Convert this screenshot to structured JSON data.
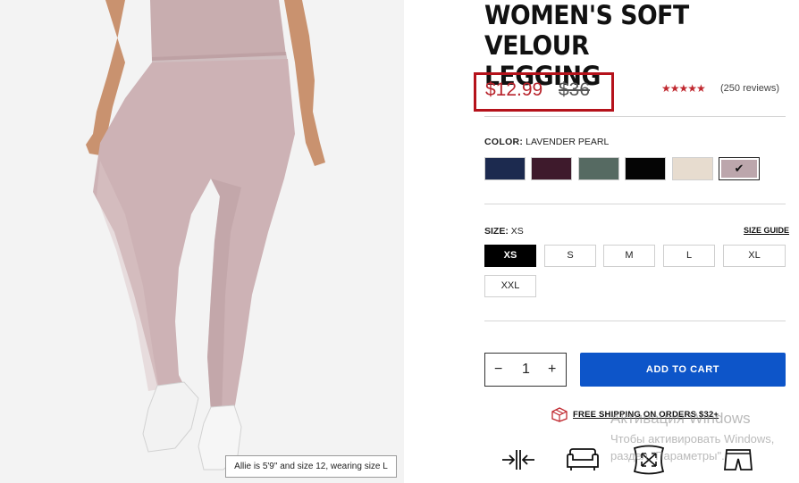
{
  "product": {
    "title_line1": "WOMEN'S SOFT VELOUR",
    "title_line2": "LEGGING",
    "sale_price": "$12.99",
    "original_price": "$36",
    "rating_stars": "★★★★★",
    "reviews": "(250 reviews)",
    "image_caption": "Allie is 5'9\" and size 12, wearing size L"
  },
  "color": {
    "label": "COLOR:",
    "value": "LAVENDER PEARL",
    "swatches": [
      {
        "name": "navy",
        "hex": "#1c2a4f"
      },
      {
        "name": "plum",
        "hex": "#3e1a2c"
      },
      {
        "name": "green",
        "hex": "#566a62"
      },
      {
        "name": "black",
        "hex": "#050505"
      },
      {
        "name": "cream",
        "hex": "#e7dccf"
      },
      {
        "name": "lavender pearl",
        "hex": "#bca6ac",
        "selected": true
      }
    ],
    "check_glyph": "✔"
  },
  "size": {
    "label": "SIZE:",
    "value": "XS",
    "guide": "SIZE GUIDE",
    "options": [
      "XS",
      "S",
      "M",
      "L",
      "XL",
      "XXL"
    ],
    "selected": "XS"
  },
  "quantity": {
    "minus": "−",
    "value": "1",
    "plus": "+"
  },
  "cart": {
    "add_label": "ADD TO CART"
  },
  "shipping": {
    "text": "FREE SHIPPING ON ORDERS $32+"
  },
  "overlay": {
    "line1": "Активация Windows",
    "line2": "Чтобы активировать Windows,",
    "line3": "раздел \"Параметры\"."
  },
  "colors": {
    "accent_red": "#b8242c",
    "highlight_border": "#b5121b",
    "cart_blue": "#0d55c9"
  },
  "icons": [
    "stretch-icon",
    "couch-icon",
    "expand-icon",
    "shorts-icon",
    "box-icon"
  ]
}
